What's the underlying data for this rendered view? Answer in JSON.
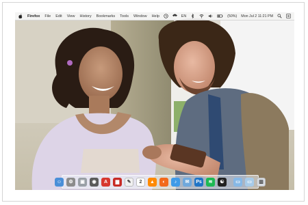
{
  "menubar": {
    "app_name": "Firefox",
    "menus": [
      "File",
      "Edit",
      "View",
      "History",
      "Bookmarks",
      "Tools",
      "Window",
      "Help"
    ],
    "input_source": "EN",
    "battery": "(50%)",
    "clock": "Mon Jul 2  11:21 PM"
  },
  "dock": {
    "apps": [
      {
        "name": "finder-icon",
        "color": "#4a8fd8",
        "glyph": "☺"
      },
      {
        "name": "system-preferences-icon",
        "color": "#8c8c8c",
        "glyph": "⚙"
      },
      {
        "name": "image-capture-icon",
        "color": "#9aa0a6",
        "glyph": "▣"
      },
      {
        "name": "photo-booth-icon",
        "color": "#5b5b5b",
        "glyph": "◉"
      },
      {
        "name": "adobe-acrobat-icon",
        "color": "#d7372f",
        "glyph": "A"
      },
      {
        "name": "red-app-icon",
        "color": "#c72b25",
        "glyph": "▆"
      },
      {
        "name": "textedit-icon",
        "color": "#f1f1f1",
        "glyph": "✎"
      },
      {
        "name": "calendar-icon",
        "color": "#ffffff",
        "glyph": "2"
      },
      {
        "name": "vlc-icon",
        "color": "#ff8a00",
        "glyph": "▲"
      },
      {
        "name": "firefox-icon",
        "color": "#f26a1b",
        "glyph": "◐"
      },
      {
        "name": "itunes-icon",
        "color": "#3f9be8",
        "glyph": "♪"
      },
      {
        "name": "mail-icon",
        "color": "#6fa8dc",
        "glyph": "✉"
      },
      {
        "name": "photoshop-icon",
        "color": "#1f74c6",
        "glyph": "Ps"
      },
      {
        "name": "spotify-icon",
        "color": "#1db954",
        "glyph": "≋"
      },
      {
        "name": "yin-yang-icon",
        "color": "#222222",
        "glyph": "☯"
      }
    ],
    "others": [
      {
        "name": "applications-folder-icon",
        "color": "#86b8e6",
        "glyph": "▭"
      },
      {
        "name": "downloads-folder-icon",
        "color": "#a7cbe9",
        "glyph": "▭"
      },
      {
        "name": "trash-icon",
        "color": "#d8dde3",
        "glyph": "▥"
      }
    ]
  }
}
